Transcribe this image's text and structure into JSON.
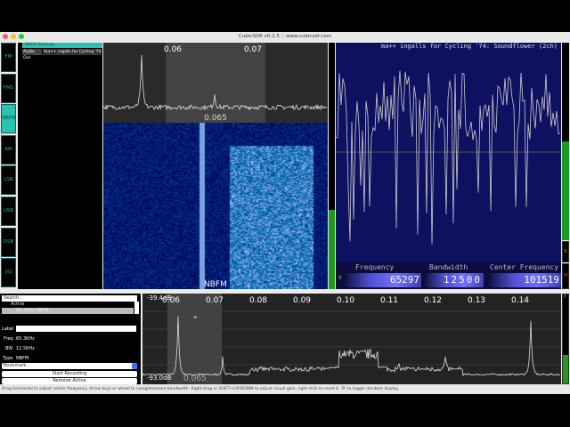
{
  "window": {
    "title": "CubicSDR v0.2.5 :: www.cubicsdr.com"
  },
  "modes": [
    {
      "label": "FM"
    },
    {
      "label": "FMS"
    },
    {
      "label": "NBFM",
      "active": true
    },
    {
      "label": "AM"
    },
    {
      "label": "LSB"
    },
    {
      "label": "USB"
    },
    {
      "label": "DSB"
    },
    {
      "label": "I/Q"
    }
  ],
  "settings": {
    "header": "NBFM Settings",
    "audio_out_label": "Audio Out",
    "audio_out_value": "ma++ ingalls for Cycling '74:"
  },
  "mini_spectrum": {
    "ticks": [
      "0.06",
      "0.07"
    ],
    "center_label": "0.065"
  },
  "waterfall": {
    "mode_label": "NBFM"
  },
  "scope": {
    "device_label": "ma++ ingalls for Cycling '74: Soundflower (2ch)"
  },
  "freq_display": {
    "frequency_label": "Frequency",
    "frequency": "65297",
    "bandwidth_label": "Bandwidth",
    "bandwidth": "12500",
    "center_label": "Center Frequency",
    "center": "101519",
    "v_label": "V",
    "s_label": "S",
    "m_label": "M"
  },
  "bookmarks": {
    "search_placeholder": "Search..",
    "group": "Active",
    "active_item": "65.3KHz NBFM",
    "label_label": "Label",
    "label_value": "",
    "freq_label": "Freq",
    "freq_value": "65.3KHz",
    "bw_label": "BW",
    "bw_value": "12.5KHz",
    "type_label": "Type",
    "type_value": "NBFM",
    "bookmark_select": "Bookmark..",
    "start_recording": "Start Recording",
    "remove_active": "Remove Active"
  },
  "spectrum": {
    "db_top": "-39.4dB",
    "db_bottom": "-93.0dB",
    "ticks": [
      "0.06",
      "0.07",
      "0.08",
      "0.09",
      "0.10",
      "0.11",
      "0.12",
      "0.13",
      "0.14"
    ],
    "center_label": "0.065",
    "p_label": "P"
  },
  "status": "Drag horizontal to adjust center frequency. Arrow keys or wheel to navigate/zoom bandwidth. Right-drag or SHIFT+UP/DOWN to adjust visual gain, right-click to reset it. 'B' to toggle decibels display.",
  "colors": {
    "accent": "#27c2b0",
    "meter": "#1e9a1e",
    "scope_bg": "#0e1060"
  }
}
